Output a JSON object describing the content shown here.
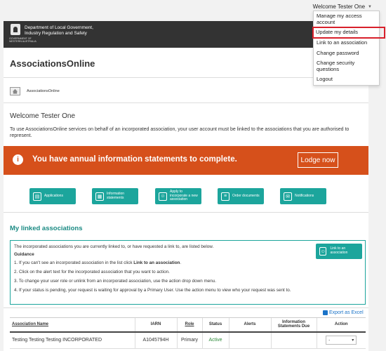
{
  "user_menu": {
    "label": "Welcome Tester One",
    "items": [
      "Manage my access account",
      "Update my details",
      "Link to an association",
      "Change password",
      "Change security questions",
      "Logout"
    ],
    "highlight_color": "#d8202b"
  },
  "header": {
    "department_line1": "Department of Local Government,",
    "department_line2": "Industry Regulation and Safety",
    "government_text": "GOVERNMENT OF WESTERN AUSTRALIA"
  },
  "app": {
    "title": "AssociationsOnline"
  },
  "breadcrumb": {
    "label": "AssociationsOnline"
  },
  "welcome": {
    "heading": "Welcome Tester One",
    "intro": "To use AssociationsOnline services on behalf of an incorporated association, your user account must be linked to the associations that you are authorised to represent."
  },
  "banner": {
    "message": "You have annual information statements to complete.",
    "button": "Lodge now",
    "color": "#d6501b"
  },
  "tiles": [
    {
      "label": "Applications",
      "icon": "document-icon"
    },
    {
      "label": "Information statements",
      "icon": "calendar-icon"
    },
    {
      "label": "Apply to incorporate a new association",
      "icon": "people-icon"
    },
    {
      "label": "Order documents",
      "icon": "order-icon"
    },
    {
      "label": "Notifications",
      "icon": "envelope-icon"
    }
  ],
  "linked": {
    "heading": "My linked associations",
    "intro": "The incorporated associations you are currently linked to, or have requested a link to, are listed below.",
    "guidance_label": "Guidance",
    "steps": [
      "1. If you can't see an incorporated association in the list click ",
      "2. Click on the alert text for the incorporated association that you want to action.",
      "3. To change your user role or unlink from an incorporated association, use the action drop down menu.",
      "4. If your status is pending, your request is waiting for approval by a Primary User. Use the action menu to view who your request was sent to."
    ],
    "step1_link": "Link to an association",
    "step1_end": ".",
    "link_button": "Link to an association"
  },
  "export": {
    "label": "Export as Excel"
  },
  "table": {
    "headers": [
      "Association Name",
      "IARN",
      "Role",
      "Status",
      "Alerts",
      "Information Statements Due",
      "Action"
    ],
    "rows": [
      {
        "name": "Testing Testing Testing INCORPORATED",
        "iarn": "A1045794H",
        "role": "Primary",
        "status": "Active",
        "alerts": "",
        "due": "",
        "action": "-"
      }
    ]
  },
  "colors": {
    "accent": "#1ca59c",
    "status_active": "#2e8b3a",
    "link": "#1a73c8"
  }
}
